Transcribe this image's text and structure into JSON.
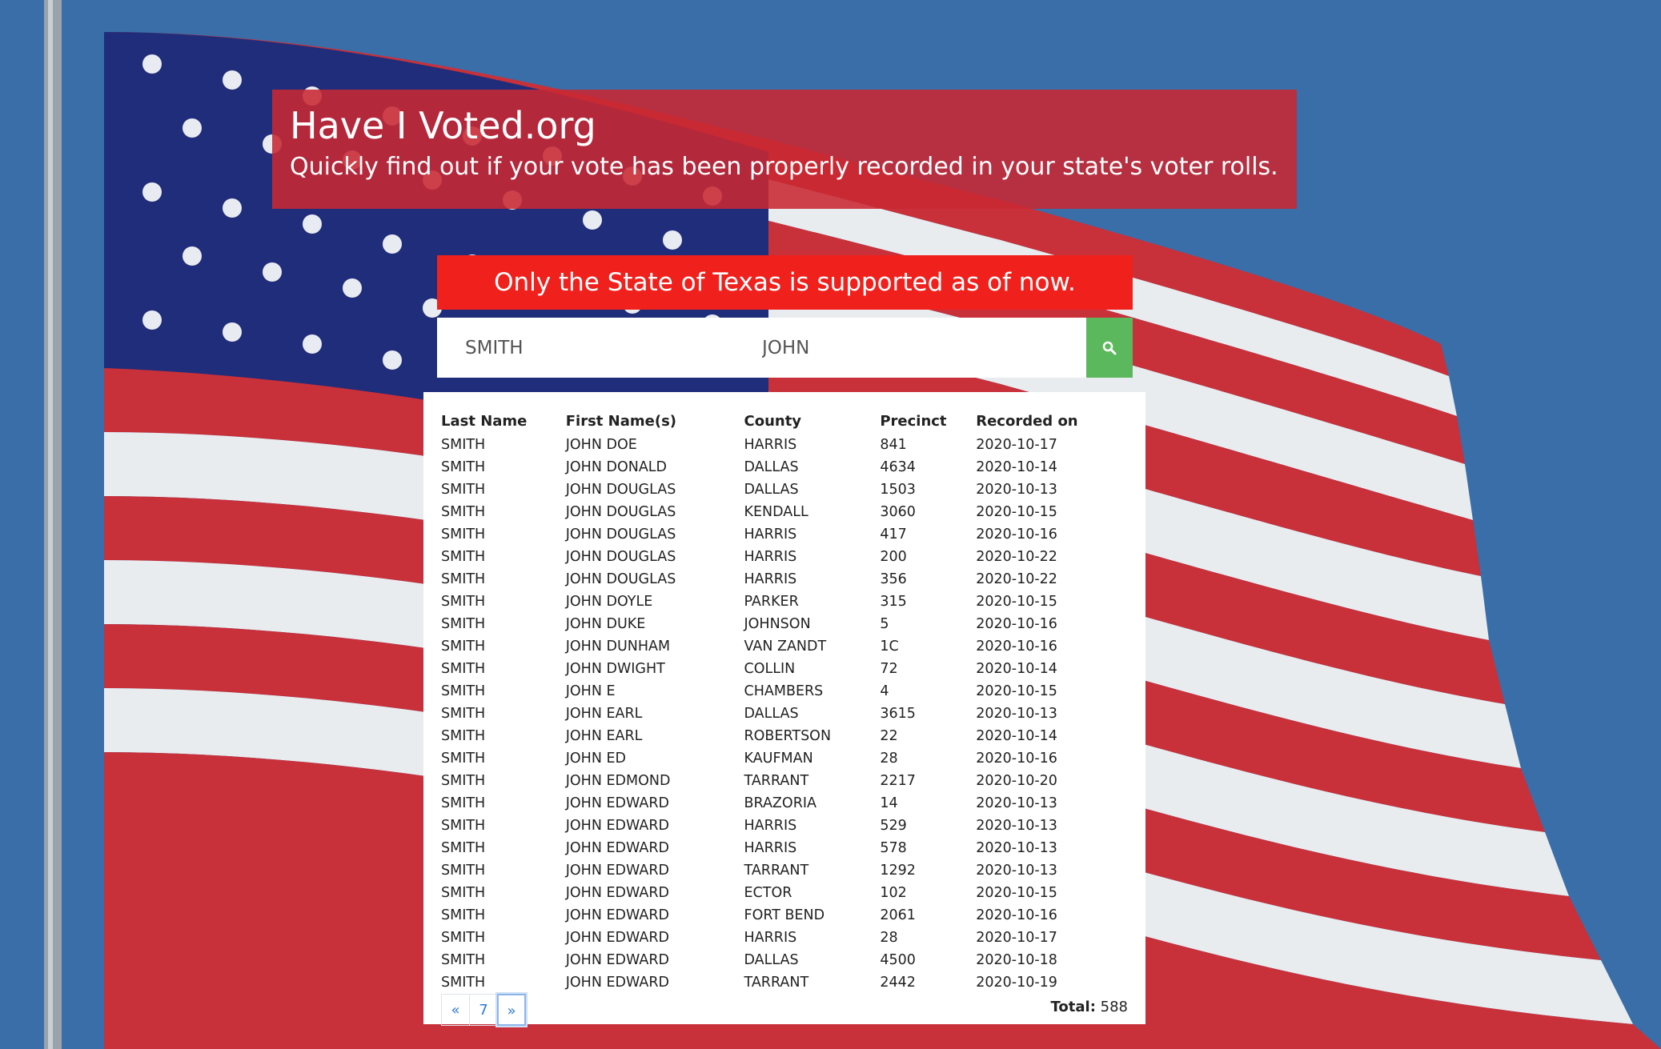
{
  "header": {
    "title": "Have I Voted.org",
    "subtitle": "Quickly find out if your vote has been properly recorded in your state's voter rolls."
  },
  "notice": "Only the State of Texas is supported as of now.",
  "search": {
    "last_name": "SMITH",
    "first_name": "JOHN",
    "button_icon": "search-icon"
  },
  "table": {
    "columns": [
      "Last Name",
      "First Name(s)",
      "County",
      "Precinct",
      "Recorded on"
    ],
    "rows": [
      [
        "SMITH",
        "JOHN DOE",
        "HARRIS",
        "841",
        "2020-10-17"
      ],
      [
        "SMITH",
        "JOHN DONALD",
        "DALLAS",
        "4634",
        "2020-10-14"
      ],
      [
        "SMITH",
        "JOHN DOUGLAS",
        "DALLAS",
        "1503",
        "2020-10-13"
      ],
      [
        "SMITH",
        "JOHN DOUGLAS",
        "KENDALL",
        "3060",
        "2020-10-15"
      ],
      [
        "SMITH",
        "JOHN DOUGLAS",
        "HARRIS",
        "417",
        "2020-10-16"
      ],
      [
        "SMITH",
        "JOHN DOUGLAS",
        "HARRIS",
        "200",
        "2020-10-22"
      ],
      [
        "SMITH",
        "JOHN DOUGLAS",
        "HARRIS",
        "356",
        "2020-10-22"
      ],
      [
        "SMITH",
        "JOHN DOYLE",
        "PARKER",
        "315",
        "2020-10-15"
      ],
      [
        "SMITH",
        "JOHN DUKE",
        "JOHNSON",
        "5",
        "2020-10-16"
      ],
      [
        "SMITH",
        "JOHN DUNHAM",
        "VAN ZANDT",
        "1C",
        "2020-10-16"
      ],
      [
        "SMITH",
        "JOHN DWIGHT",
        "COLLIN",
        "72",
        "2020-10-14"
      ],
      [
        "SMITH",
        "JOHN E",
        "CHAMBERS",
        "4",
        "2020-10-15"
      ],
      [
        "SMITH",
        "JOHN EARL",
        "DALLAS",
        "3615",
        "2020-10-13"
      ],
      [
        "SMITH",
        "JOHN EARL",
        "ROBERTSON",
        "22",
        "2020-10-14"
      ],
      [
        "SMITH",
        "JOHN ED",
        "KAUFMAN",
        "28",
        "2020-10-16"
      ],
      [
        "SMITH",
        "JOHN EDMOND",
        "TARRANT",
        "2217",
        "2020-10-20"
      ],
      [
        "SMITH",
        "JOHN EDWARD",
        "BRAZORIA",
        "14",
        "2020-10-13"
      ],
      [
        "SMITH",
        "JOHN EDWARD",
        "HARRIS",
        "529",
        "2020-10-13"
      ],
      [
        "SMITH",
        "JOHN EDWARD",
        "HARRIS",
        "578",
        "2020-10-13"
      ],
      [
        "SMITH",
        "JOHN EDWARD",
        "TARRANT",
        "1292",
        "2020-10-13"
      ],
      [
        "SMITH",
        "JOHN EDWARD",
        "ECTOR",
        "102",
        "2020-10-15"
      ],
      [
        "SMITH",
        "JOHN EDWARD",
        "FORT BEND",
        "2061",
        "2020-10-16"
      ],
      [
        "SMITH",
        "JOHN EDWARD",
        "HARRIS",
        "28",
        "2020-10-17"
      ],
      [
        "SMITH",
        "JOHN EDWARD",
        "DALLAS",
        "4500",
        "2020-10-18"
      ],
      [
        "SMITH",
        "JOHN EDWARD",
        "TARRANT",
        "2442",
        "2020-10-19"
      ]
    ]
  },
  "pagination": {
    "prev": "«",
    "page": "7",
    "next": "»"
  },
  "total": {
    "label": "Total:",
    "value": "588"
  },
  "colors": {
    "hero_bg": "#c82832",
    "notice_bg": "#f0201c",
    "search_button": "#5cb85c",
    "link": "#2a7ad9"
  }
}
